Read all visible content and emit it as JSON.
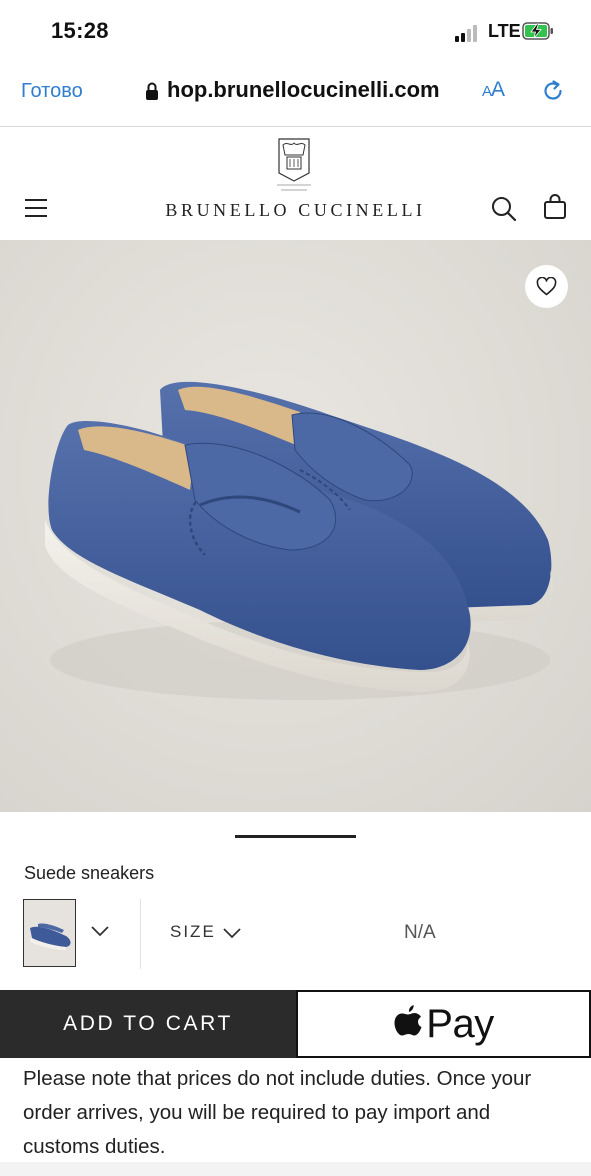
{
  "status_bar": {
    "time": "15:28",
    "network": "LTE"
  },
  "browser": {
    "done_label": "Готово",
    "url": "hop.brunellocucinelli.com",
    "text_size_label": "AA"
  },
  "header": {
    "brand_name": "BRUNELLO CUCINELLI"
  },
  "product": {
    "name": "Suede sneakers",
    "size_label": "SIZE",
    "size_value": "N/A",
    "shoe_color": "#3f5a98",
    "sole_color": "#f2f0ea"
  },
  "actions": {
    "add_to_cart_label": "ADD TO CART",
    "apple_pay_label": "Pay"
  },
  "note": {
    "text": "Please note that prices do not include duties. Once your order arrives, you will be required to pay import and customs duties."
  },
  "colors": {
    "link_blue": "#2f7fd0",
    "dark_button": "#2b2b2b"
  }
}
